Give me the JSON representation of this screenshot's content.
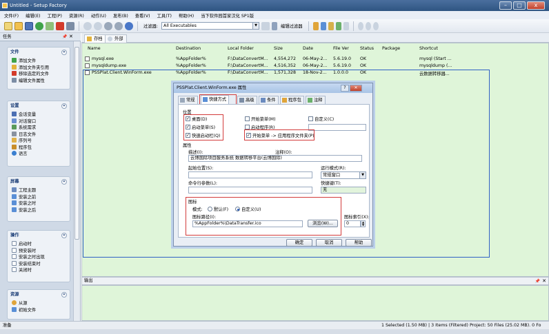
{
  "window": {
    "title": "Untitled - Setup Factory",
    "min": "–",
    "max": "□",
    "close": "x"
  },
  "menu": [
    "文件(F)",
    "编辑(E)",
    "工程(P)",
    "资源(R)",
    "动作(U)",
    "发布(B)",
    "查看(V)",
    "工具(T)",
    "帮助(H)",
    "当下软件园首家汉化 SP1版"
  ],
  "toolbar": {
    "filter_label": "过滤器:",
    "filter_value": "All Executables",
    "edit_filter": "编辑过滤器"
  },
  "left_panel": {
    "title": "任务",
    "groups": [
      {
        "title": "文件",
        "items": [
          "添加文件",
          "添加文件夹引用",
          "移除选定的文件",
          "编辑文件属性"
        ]
      },
      {
        "title": "设置",
        "items": [
          "会话变量",
          "对话窗口",
          "系统需求",
          "日志文件",
          "序列号",
          "程序包",
          "语言"
        ]
      },
      {
        "title": "屏幕",
        "items": [
          "工程主题",
          "安装之前",
          "安装之时",
          "安装之后"
        ]
      },
      {
        "title": "操作",
        "items": [
          "启动时",
          "预安装时",
          "安装之时出现",
          "安装结束时",
          "关闭时"
        ]
      },
      {
        "title": "资源",
        "items": [
          "从源",
          "初始文件"
        ]
      }
    ]
  },
  "tabs": [
    "存档",
    "外部"
  ],
  "file_table": {
    "columns": [
      "Name",
      "Destination",
      "Local Folder",
      "Size",
      "Date",
      "File Ver",
      "Status",
      "Package",
      "Shortcut"
    ],
    "rows": [
      [
        "mysql.exe",
        "%AppFolder%",
        "F:\\DataConvertM...",
        "4,554,272",
        "06-May-2...",
        "5.6.19.0",
        "OK",
        "",
        "mysql (Start ..."
      ],
      [
        "mysqldump.exe",
        "%AppFolder%",
        "F:\\DataConvertM...",
        "4,516,352",
        "06-May-2...",
        "5.6.19.0",
        "OK",
        "",
        "mysqldump (..."
      ],
      [
        "PSSPlat.Client.WinForm.exe",
        "%AppFolder%",
        "F:\\DataConvertM...",
        "1,571,328",
        "18-Nov-2...",
        "1.0.0.0",
        "OK",
        "",
        "云数据转移器..."
      ]
    ]
  },
  "dialog": {
    "title": "PSSPlat.Client.WinForm.exe 属性",
    "tabs": [
      "常规",
      "快捷方式",
      "高级",
      "条件",
      "程序包",
      "注释"
    ],
    "location_label": "位置",
    "checks": [
      "桌面(D)",
      "开始菜单(M)",
      "自定义(C)",
      "启动菜单(S)",
      "启动程序(R)",
      "快速启动栏(Q)",
      "开始菜单 -> 应用程序文件夹(P)"
    ],
    "properties_label": "属性",
    "desc_label": "描述(I):",
    "comment_label": "注释(O):",
    "desc_value": "云博国际项目服务系统 数据转移平台(云博国际)",
    "start_in_label": "起始位置(S):",
    "run_mode_label": "运行模式(R):",
    "run_mode_value": "常规窗口",
    "cmd_label": "命令行参数(L):",
    "hotkey_label": "快捷键(T):",
    "hotkey_value": "无",
    "icon_label": "图标",
    "mode_label": "模式:",
    "default_label": "默认(F)",
    "custom_label": "自定义(U)",
    "icon_path_label": "图标路径(I):",
    "icon_path_value": "%AppFolder%\\DataTransfer.ico",
    "browse": "浏览(W)...",
    "icon_index_label": "图标索引(X):",
    "icon_index_value": "0",
    "ok": "确定",
    "cancel": "取消",
    "help": "帮助"
  },
  "output_title": "输出",
  "status": {
    "left": "准备",
    "right": "1 Selected (1.50 MB)  |  3 Items (Filtered) Project: 50 Files (25.02 MB). 0 Fo"
  }
}
